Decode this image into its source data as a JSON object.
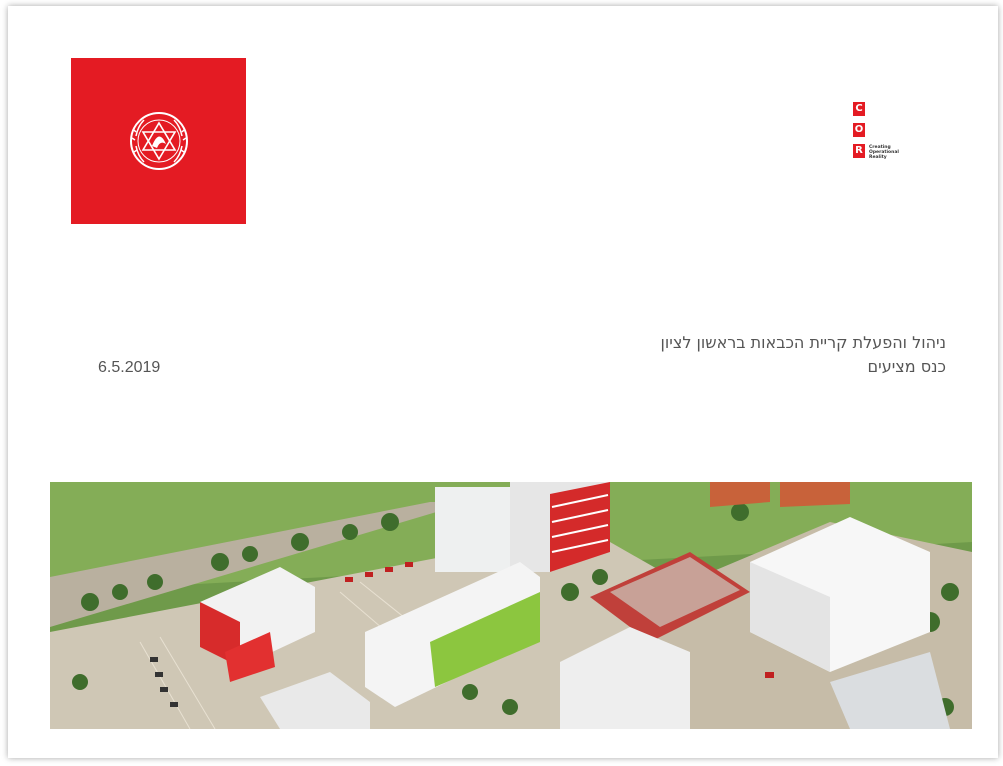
{
  "logo": {
    "name": "fire-and-rescue-emblem",
    "bg_color": "#e41b23",
    "emblem_text": "כבאות והצלה"
  },
  "cor_logo": {
    "letters": [
      "C",
      "O",
      "R"
    ],
    "tagline": "Creating\nOperational\nReality",
    "color": "#e41b23"
  },
  "document": {
    "date": "6.5.2019",
    "title_line1": "ניהול והפעלת קריית הכבאות בראשון לציון",
    "title_line2": "כנס מציעים"
  },
  "image": {
    "name": "aerial-campus-render"
  }
}
